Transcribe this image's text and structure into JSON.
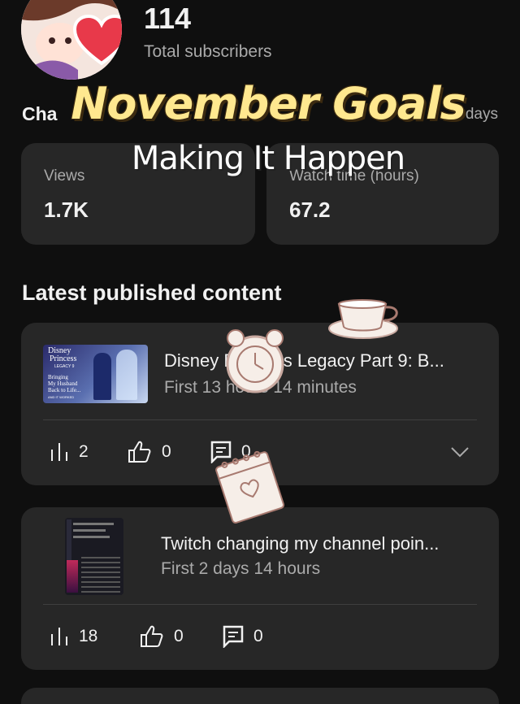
{
  "channel": {
    "subscriber_count": "114",
    "subscriber_label": "Total subscribers"
  },
  "analytics": {
    "heading_partial": "Cha",
    "range_partial": "days",
    "views_label": "Views",
    "views_value": "1.7K",
    "watch_label": "Watch time (hours)",
    "watch_value": "67.2"
  },
  "overlay": {
    "title": "November Goals",
    "subtitle": "Making It Happen"
  },
  "latest": {
    "heading": "Latest published content",
    "videos": [
      {
        "title": "Disney Princess Legacy Part 9: B...",
        "subtitle": "First 13 hours 14 minutes",
        "views": "2",
        "likes": "0",
        "comments": "0",
        "thumb_text": {
          "brand": "Disney",
          "line1": "Princess",
          "line2": "LEGACY 9",
          "caption1": "Bringing",
          "caption2": "My Husband",
          "caption3": "Back to Life...",
          "caption4": "AND IT WORKED"
        }
      },
      {
        "title": "Twitch changing my channel poin...",
        "subtitle": "First 2 days 14 hours",
        "views": "18",
        "likes": "0",
        "comments": "0"
      }
    ]
  },
  "colors": {
    "background": "#0f0f0f",
    "card": "#272727",
    "overlay_title": "#ffe88f",
    "heart": "#e8394a"
  }
}
